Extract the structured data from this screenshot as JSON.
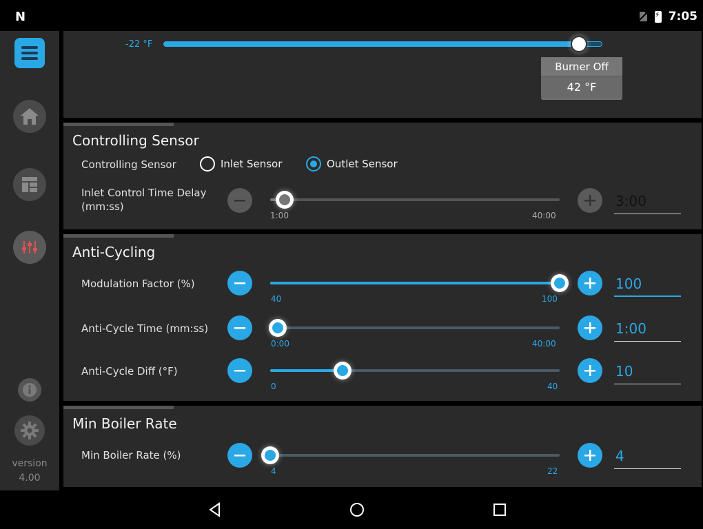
{
  "status_bar": {
    "logo": "N",
    "time": "7:05"
  },
  "nav": {
    "version_label": "version",
    "version_number": "4.00"
  },
  "top": {
    "min_label": "-22 °F",
    "burner_status": "Burner Off",
    "burner_temp": "42 °F",
    "slider_fraction": 0.95
  },
  "controlling": {
    "title": "Controlling Sensor",
    "sensor_label": "Controlling Sensor",
    "inlet_option": "Inlet Sensor",
    "outlet_option": "Outlet Sensor",
    "selected": "Outlet Sensor",
    "delay_label_line1": "Inlet Control Time Delay",
    "delay_label_line2": "(mm:ss)",
    "delay_min": "1:00",
    "delay_max": "40:00",
    "delay_value": "3:00",
    "delay_fraction": 0.05
  },
  "anti_cycling": {
    "title": "Anti-Cycling",
    "modulation": {
      "label": "Modulation Factor (%)",
      "min": "40",
      "max": "100",
      "value": "100",
      "fraction": 1.0
    },
    "cycle_time": {
      "label": "Anti-Cycle Time (mm:ss)",
      "min": "0:00",
      "max": "40:00",
      "value": "1:00",
      "fraction": 0.025
    },
    "cycle_diff": {
      "label": "Anti-Cycle Diff (°F)",
      "min": "0",
      "max": "40",
      "value": "10",
      "fraction": 0.25
    }
  },
  "min_boiler": {
    "title": "Min Boiler Rate",
    "rate": {
      "label": "Min Boiler Rate (%)",
      "min": "4",
      "max": "22",
      "value": "4",
      "fraction": 0.0
    }
  },
  "colors": {
    "accent": "#2aa8e6",
    "panel": "#2a2a2a",
    "rail": "#2b2b2b"
  }
}
